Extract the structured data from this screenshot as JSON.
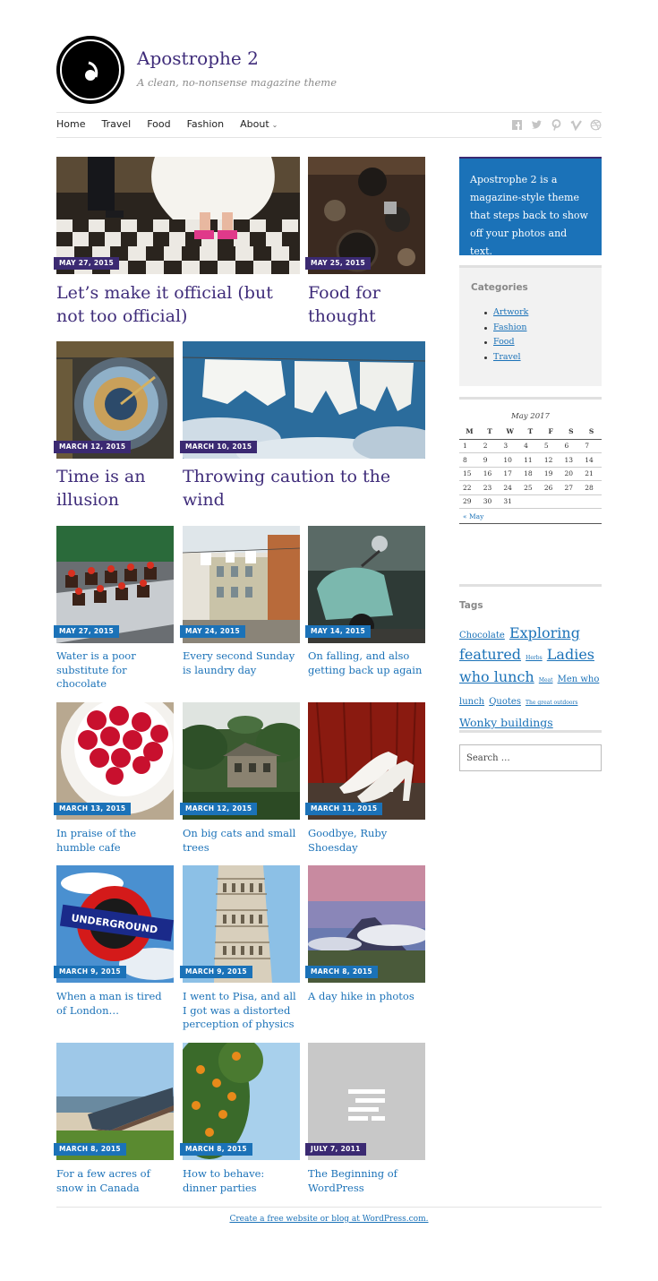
{
  "site": {
    "title": "Apostrophe 2",
    "description": "A clean, no-nonsense magazine theme"
  },
  "nav": {
    "home": "Home",
    "travel": "Travel",
    "food": "Food",
    "fashion": "Fashion",
    "about": "About",
    "about_caret": "⌄"
  },
  "featured": [
    {
      "date": "MAY 27, 2015",
      "title": "Let’s make it official (but not too official)"
    },
    {
      "date": "MAY 25, 2015",
      "title": "Food for thought"
    },
    {
      "date": "MARCH 12, 2015",
      "title": "Time is an illusion"
    },
    {
      "date": "MARCH 10, 2015",
      "title": "Throwing caution to the wind"
    }
  ],
  "posts": [
    {
      "date": "MAY 27, 2015",
      "title": "Water is a poor substitute for chocolate"
    },
    {
      "date": "MAY 24, 2015",
      "title": "Every second Sunday is laundry day"
    },
    {
      "date": "MAY 14, 2015",
      "title": "On falling, and also getting back up again"
    },
    {
      "date": "MARCH 13, 2015",
      "title": "In praise of the humble cafe"
    },
    {
      "date": "MARCH 12, 2015",
      "title": "On big cats and small trees"
    },
    {
      "date": "MARCH 11, 2015",
      "title": "Goodbye, Ruby Shoesday"
    },
    {
      "date": "MARCH 9, 2015",
      "title": "When a man is tired of London…"
    },
    {
      "date": "MARCH 9, 2015",
      "title": "I went to Pisa, and all I got was a distorted perception of physics"
    },
    {
      "date": "MARCH 8, 2015",
      "title": "A day hike in photos"
    },
    {
      "date": "MARCH 8, 2015",
      "title": "For a few acres of snow in Canada"
    },
    {
      "date": "MARCH 8, 2015",
      "title": "How to behave: dinner parties"
    },
    {
      "date": "JULY 7, 2011",
      "title": "The Beginning of WordPress"
    }
  ],
  "sidebar": {
    "about_text": "Apostrophe 2 is a magazine-style theme that steps back to show off your photos and text.",
    "categories_title": "Categories",
    "categories": [
      "Artwork",
      "Fashion",
      "Food",
      "Travel"
    ],
    "calendar": {
      "caption": "May 2017",
      "days": [
        "M",
        "T",
        "W",
        "T",
        "F",
        "S",
        "S"
      ],
      "weeks": [
        [
          "1",
          "2",
          "3",
          "4",
          "5",
          "6",
          "7"
        ],
        [
          "8",
          "9",
          "10",
          "11",
          "12",
          "13",
          "14"
        ],
        [
          "15",
          "16",
          "17",
          "18",
          "19",
          "20",
          "21"
        ],
        [
          "22",
          "23",
          "24",
          "25",
          "26",
          "27",
          "28"
        ],
        [
          "29",
          "30",
          "31",
          "",
          "",
          "",
          ""
        ]
      ],
      "prev": "« May"
    },
    "tags_title": "Tags",
    "tags": [
      {
        "label": "Chocolate",
        "size": "small"
      },
      {
        "label": "Exploring",
        "size": "big"
      },
      {
        "label": "featured",
        "size": "big"
      },
      {
        "label": "Herbs",
        "size": "tiny"
      },
      {
        "label": "Ladies who lunch",
        "size": "big"
      },
      {
        "label": "Meat",
        "size": "tiny"
      },
      {
        "label": "Men who lunch",
        "size": "small"
      },
      {
        "label": "Quotes",
        "size": "small"
      },
      {
        "label": "The great outdoors",
        "size": "tiny"
      },
      {
        "label": "Wonky buildings",
        "size": "medium"
      }
    ],
    "search_placeholder": "Search …"
  },
  "footer": {
    "credit": "Create a free website or blog at WordPress.com."
  },
  "colors": {
    "title_purple": "#3f2c7a",
    "link_blue": "#1b72b8",
    "badge_purple": "#3b2a72",
    "badge_blue": "#1b72b8"
  }
}
